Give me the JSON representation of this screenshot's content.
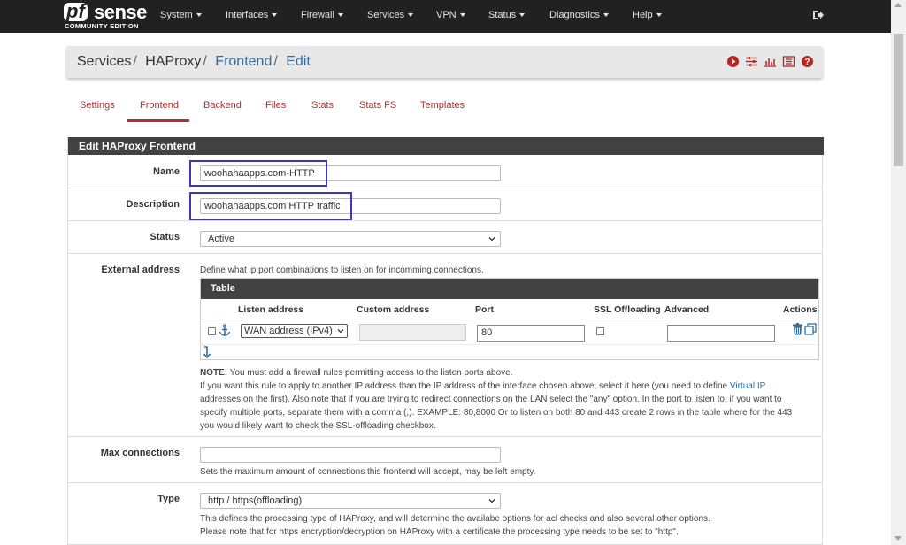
{
  "logo": {
    "pf": "pf",
    "sense": "sense",
    "edition": "COMMUNITY EDITION"
  },
  "nav": {
    "items": [
      "System",
      "Interfaces",
      "Firewall",
      "Services",
      "VPN",
      "Status",
      "Diagnostics",
      "Help"
    ]
  },
  "breadcrumb": {
    "services": "Services",
    "haproxy": "HAProxy",
    "frontend": "Frontend",
    "edit": "Edit",
    "sep": "/"
  },
  "tabs": [
    "Settings",
    "Frontend",
    "Backend",
    "Files",
    "Stats",
    "Stats FS",
    "Templates"
  ],
  "active_tab": "Frontend",
  "panel": {
    "heading": "Edit HAProxy Frontend"
  },
  "fields": {
    "name": {
      "label": "Name",
      "value": "woohahaapps.com-HTTP"
    },
    "description": {
      "label": "Description",
      "value": "woohahaapps.com HTTP traffic"
    },
    "status": {
      "label": "Status",
      "value": "Active"
    },
    "external": {
      "label": "External address",
      "hint": "Define what ip:port combinations to listen on for incomming connections.",
      "table_title": "Table",
      "columns": [
        "Listen address",
        "Custom address",
        "Port",
        "SSL Offloading",
        "Advanced",
        "Actions"
      ],
      "row": {
        "listen_address": "WAN address (IPv4)",
        "custom_address": "",
        "port": "80",
        "advanced": ""
      },
      "note_label": "NOTE:",
      "note_line1": " You must add a firewall rules permitting access to the listen ports above.",
      "note_line2a": "If you want this rule to apply to another IP address than the IP address of the interface chosen above, select it here (you need to define ",
      "note_link": "Virtual IP",
      "note_line3": "addresses on the first). Also note that if you are trying to redirect connections on the LAN select the \"any\" option. In the port to listen to, if you want to",
      "note_line4": "specify multiple ports, separate them with a comma (,). EXAMPLE: 80,8000 Or to listen on both 80 and 443 create 2 rows in the table where for the 443",
      "note_line5": "you would likely want to check the SSL-offloading checkbox."
    },
    "max_connections": {
      "label": "Max connections",
      "value": "",
      "hint": "Sets the maximum amount of connections this frontend will accept, may be left empty."
    },
    "type": {
      "label": "Type",
      "value": "http / https(offloading)",
      "hint1": "This defines the processing type of HAProxy, and will determine the availabe options for acl checks and also several other options.",
      "hint2": "Please note that for https encryption/decryption on HAProxy with a certificate the processing type needs to be set to \"http\"."
    }
  },
  "colors": {
    "navbar": "#212121",
    "accent": "#a33333",
    "link": "#2e6da4",
    "panel_heading": "#424242",
    "highlight": "#3a3ab8"
  }
}
